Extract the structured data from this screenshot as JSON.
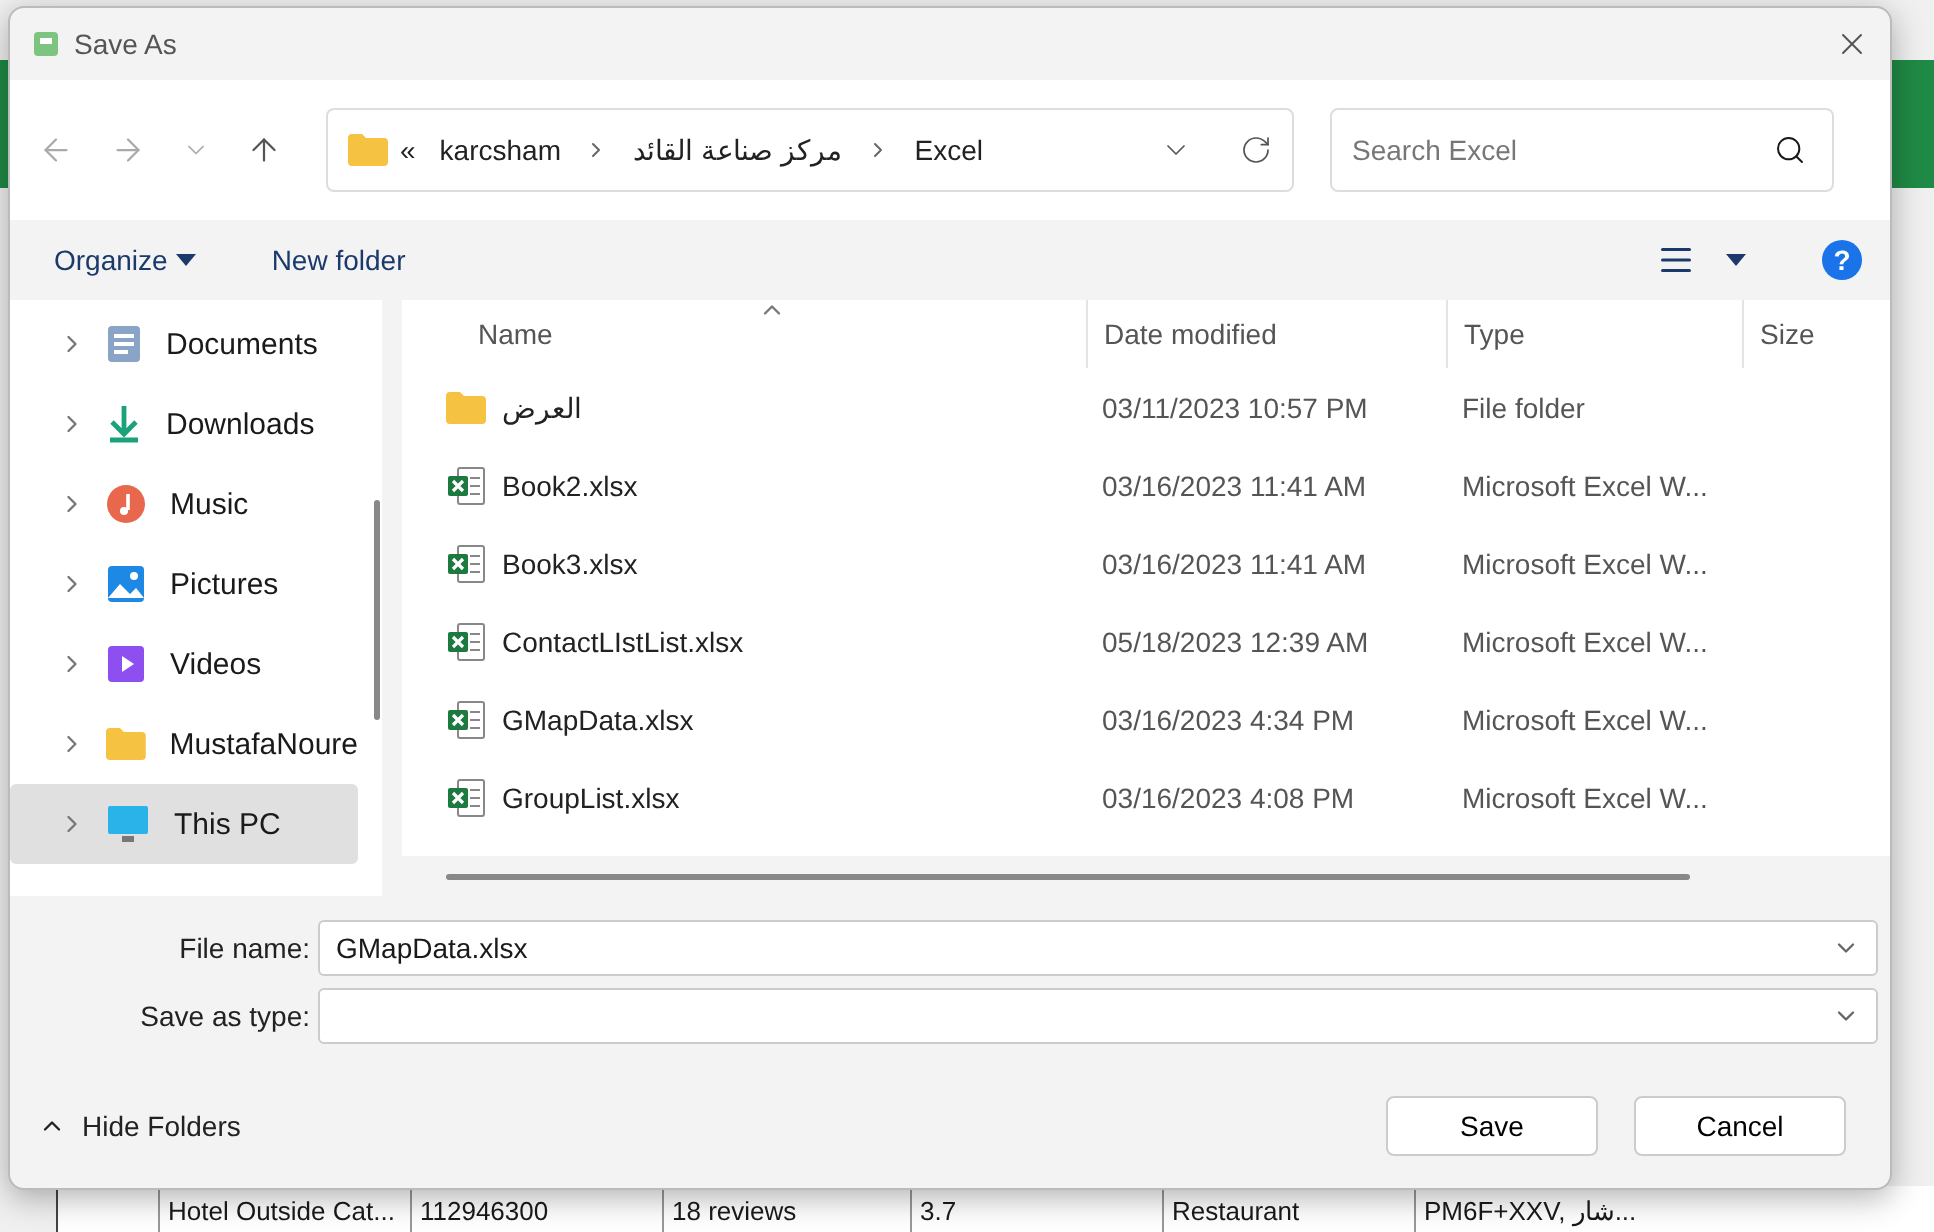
{
  "window": {
    "title": "Save As"
  },
  "address": {
    "overflow": "«",
    "segments": [
      "karcsham",
      "مركز صناعة القائد",
      "Excel"
    ]
  },
  "search": {
    "placeholder": "Search Excel"
  },
  "toolbar": {
    "organize": "Organize",
    "new_folder": "New folder",
    "help": "?"
  },
  "sidebar": {
    "items": [
      {
        "label": "Documents",
        "kind": "documents",
        "selected": false
      },
      {
        "label": "Downloads",
        "kind": "downloads",
        "selected": false
      },
      {
        "label": "Music",
        "kind": "music",
        "selected": false
      },
      {
        "label": "Pictures",
        "kind": "pictures",
        "selected": false
      },
      {
        "label": "Videos",
        "kind": "videos",
        "selected": false
      },
      {
        "label": "MustafaNoure",
        "kind": "folder",
        "selected": false
      },
      {
        "label": "This PC",
        "kind": "pc",
        "selected": true
      }
    ]
  },
  "table": {
    "columns": [
      "Name",
      "Date modified",
      "Type",
      "Size"
    ],
    "rows": [
      {
        "kind": "folder",
        "name": "العرض",
        "date": "03/11/2023 10:57 PM",
        "type": "File folder"
      },
      {
        "kind": "excel",
        "name": "Book2.xlsx",
        "date": "03/16/2023 11:41 AM",
        "type": "Microsoft Excel W..."
      },
      {
        "kind": "excel",
        "name": "Book3.xlsx",
        "date": "03/16/2023 11:41 AM",
        "type": "Microsoft Excel W..."
      },
      {
        "kind": "excel",
        "name": "ContactLIstList.xlsx",
        "date": "05/18/2023 12:39 AM",
        "type": "Microsoft Excel W..."
      },
      {
        "kind": "excel",
        "name": "GMapData.xlsx",
        "date": "03/16/2023 4:34 PM",
        "type": "Microsoft Excel W..."
      },
      {
        "kind": "excel",
        "name": "GroupList.xlsx",
        "date": "03/16/2023 4:08 PM",
        "type": "Microsoft Excel W..."
      }
    ]
  },
  "form": {
    "file_name_label": "File name:",
    "file_name": "GMapData.xlsx",
    "type_label": "Save as type:"
  },
  "footer": {
    "hide_folders": "Hide Folders",
    "save": "Save",
    "cancel": "Cancel"
  },
  "background_row": {
    "cells": [
      "Hotel Outside Cat...",
      "112946300",
      "18 reviews",
      "3.7",
      "Restaurant",
      "PM6F+XXV, شار..."
    ]
  }
}
